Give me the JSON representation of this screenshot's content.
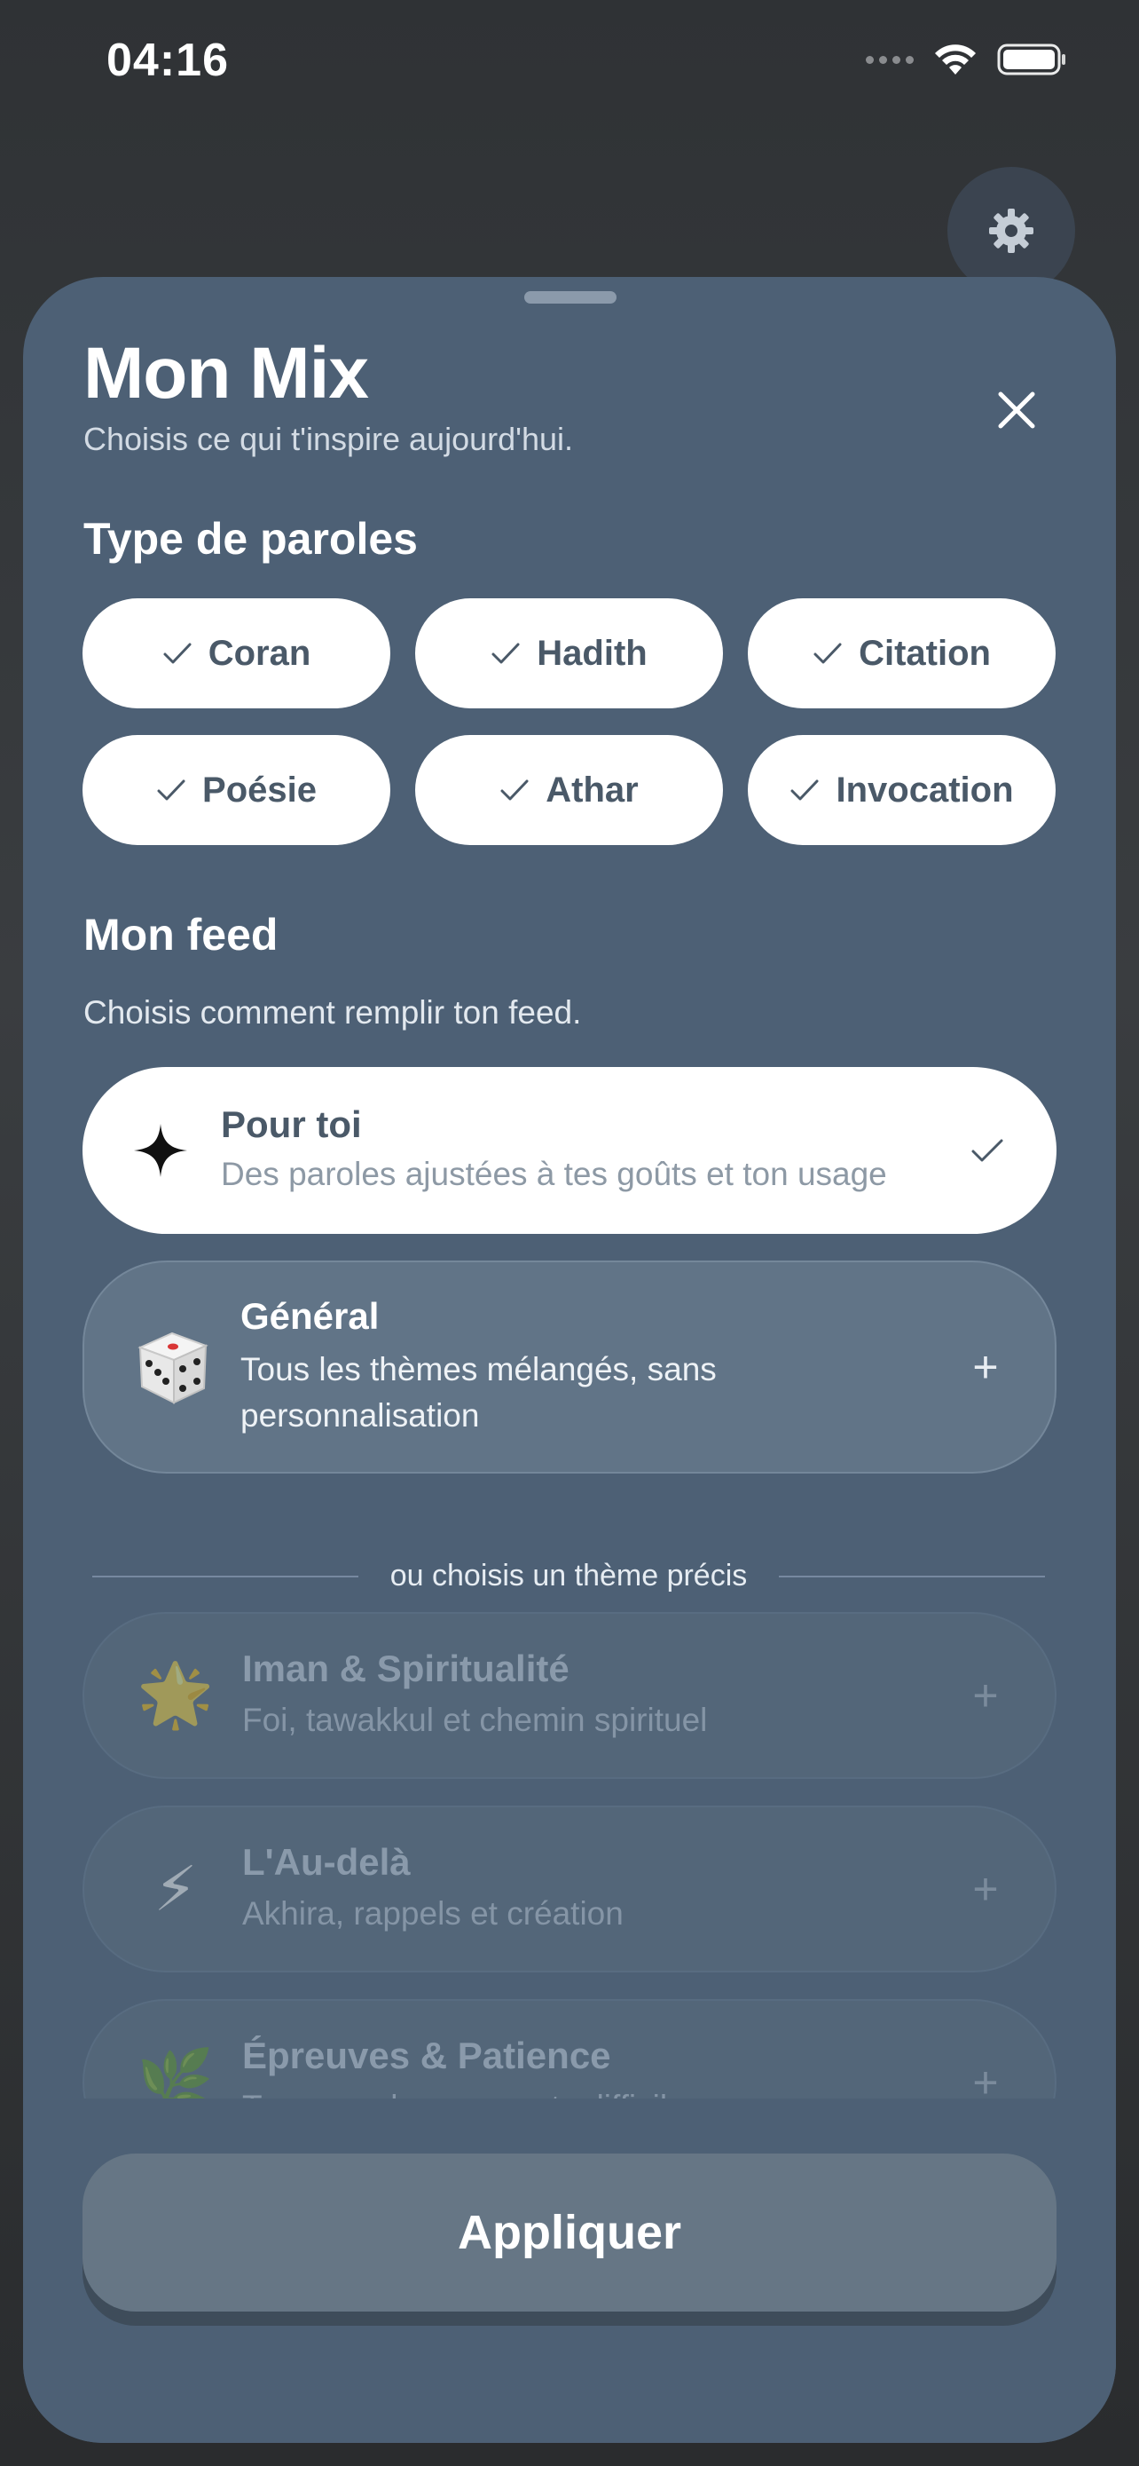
{
  "status_bar": {
    "time": "04:16"
  },
  "sheet": {
    "title": "Mon Mix",
    "subtitle": "Choisis ce qui t'inspire aujourd'hui.",
    "type_section": {
      "title": "Type de paroles",
      "chips": [
        {
          "label": "Coran",
          "selected": true
        },
        {
          "label": "Hadith",
          "selected": true
        },
        {
          "label": "Citation",
          "selected": true
        },
        {
          "label": "Poésie",
          "selected": true
        },
        {
          "label": "Athar",
          "selected": true
        },
        {
          "label": "Invocation",
          "selected": true
        }
      ]
    },
    "feed_section": {
      "title": "Mon feed",
      "description": "Choisis comment remplir ton feed.",
      "options": [
        {
          "title": "Pour toi",
          "description": "Des paroles ajustées à tes goûts et ton usage",
          "icon": "sparkle-icon",
          "selected": true
        },
        {
          "title": "Général",
          "description_line1": "Tous les thèmes mélangés, sans",
          "description_line2": "personnalisation",
          "icon": "dice-icon",
          "selected": false
        }
      ]
    },
    "divider_text": "ou choisis un thème précis",
    "themes": [
      {
        "title": "Iman & Spiritualité",
        "description": "Foi, tawakkul et chemin spirituel",
        "icon": "🌟"
      },
      {
        "title": "L'Au-delà",
        "description": "Akhira, rappels et création",
        "icon": "⚡"
      },
      {
        "title": "Épreuves & Patience",
        "description": "Traverser les moments difficiles",
        "icon": "🌿"
      }
    ],
    "apply_button": "Appliquer"
  },
  "colors": {
    "sheet": "#4d6075",
    "chip_text": "#4a5968",
    "apply": "#667685"
  }
}
